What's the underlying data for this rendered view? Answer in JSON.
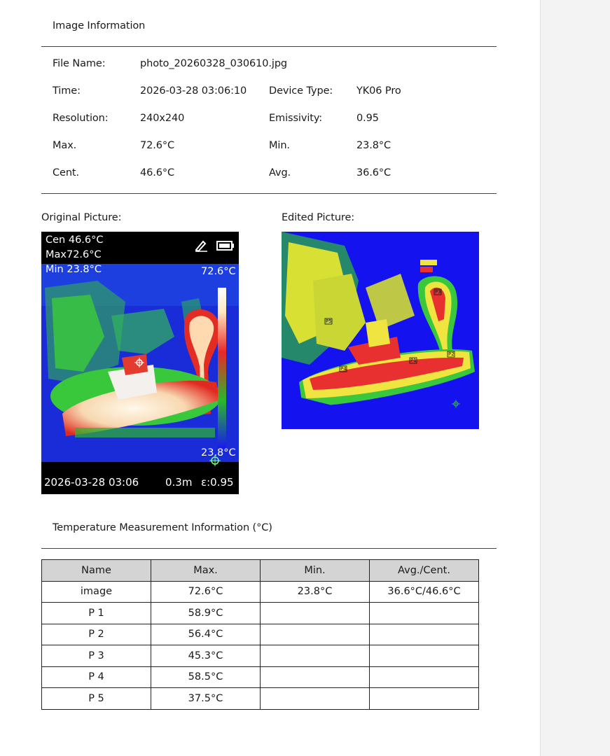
{
  "header": {
    "title": "Image Information"
  },
  "info": {
    "file_name_label": "File Name:",
    "file_name_value": "photo_20260328_030610.jpg",
    "time_label": "Time:",
    "time_value": "2026-03-28 03:06:10",
    "device_label": "Device Type:",
    "device_value": "YK06 Pro",
    "resolution_label": "Resolution:",
    "resolution_value": "240x240",
    "emissivity_label": "Emissivity:",
    "emissivity_value": "0.95",
    "max_label": "Max.",
    "max_value": "72.6°C",
    "min_label": "Min.",
    "min_value": "23.8°C",
    "cent_label": "Cent.",
    "cent_value": "46.6°C",
    "avg_label": "Avg.",
    "avg_value": "36.6°C"
  },
  "pictures": {
    "original_label": "Original Picture:",
    "edited_label": "Edited Picture:",
    "overlay": {
      "cen": "Cen 46.6°C",
      "max": "Max72.6°C",
      "min": "Min 23.8°C",
      "scale_max": "72.6°C",
      "scale_min": "23.8°C",
      "datetime": "2026-03-28 03:06",
      "distance": "0.3m",
      "emissivity": "ε:0.95"
    },
    "points": [
      "P1",
      "P2",
      "P3",
      "P4",
      "P5"
    ]
  },
  "measurement": {
    "title": "Temperature Measurement Information (°C)",
    "columns": [
      "Name",
      "Max.",
      "Min.",
      "Avg./Cent."
    ],
    "rows": [
      {
        "name": "image",
        "max": "72.6°C",
        "min": "23.8°C",
        "avg": "36.6°C/46.6°C"
      },
      {
        "name": "P 1",
        "max": "58.9°C",
        "min": "",
        "avg": ""
      },
      {
        "name": "P 2",
        "max": "56.4°C",
        "min": "",
        "avg": ""
      },
      {
        "name": "P 3",
        "max": "45.3°C",
        "min": "",
        "avg": ""
      },
      {
        "name": "P 4",
        "max": "58.5°C",
        "min": "",
        "avg": ""
      },
      {
        "name": "P 5",
        "max": "37.5°C",
        "min": "",
        "avg": ""
      }
    ]
  },
  "colors": {
    "cold": "#1a1aef",
    "mid": "#39c83c",
    "warm": "#f0f040",
    "hot": "#e83030",
    "hottest": "#fff6e6"
  }
}
